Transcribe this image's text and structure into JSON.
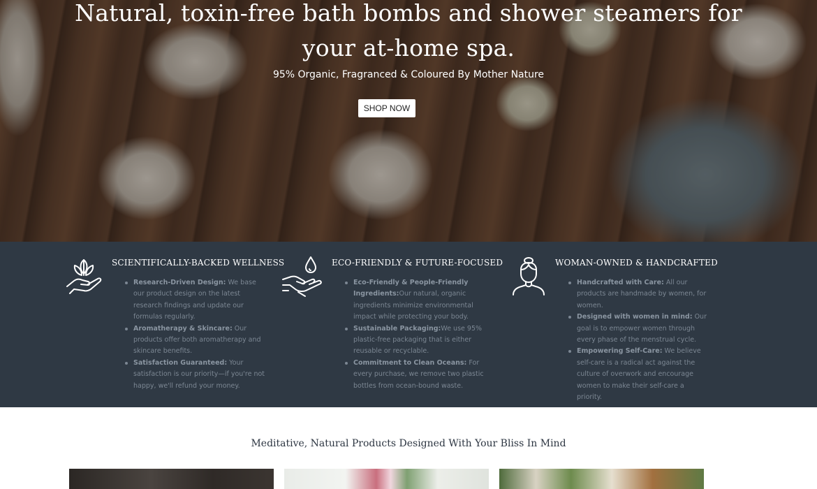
{
  "hero": {
    "title": "Natural, toxin-free bath bombs and shower steamers for your at-home spa.",
    "subtitle": "95% Organic, Fragranced & Coloured By Mother Nature",
    "cta_label": "SHOP NOW"
  },
  "features": [
    {
      "icon": "hand-plant-icon",
      "title": "SCIENTIFICALLY-BACKED WELLNESS",
      "items": [
        {
          "heading": "Research-Driven Design:",
          "text": " We base our product design on the latest research findings and update our formulas regularly."
        },
        {
          "heading": "Aromatherapy & Skincare:",
          "text": " Our products offer both aromatherapy and skincare benefits."
        },
        {
          "heading": "Satisfaction Guaranteed:",
          "text": " Your satisfaction is our priority—if you're not happy, we'll refund your money."
        }
      ]
    },
    {
      "icon": "hand-water-drop-icon",
      "title": "ECO-FRIENDLY & FUTURE-FOCUSED",
      "items": [
        {
          "heading": "Eco-Friendly & People-Friendly Ingredients:",
          "text": "Our natural, organic ingredients minimize environmental impact while protecting your body."
        },
        {
          "heading": "Sustainable Packaging:",
          "text": "We use 95% plastic-free packaging that is either reusable or recyclable."
        },
        {
          "heading": "Commitment to Clean Oceans:",
          "text": " For every purchase, we remove two plastic bottles from ocean-bound waste."
        }
      ]
    },
    {
      "icon": "woman-icon",
      "title": "WOMAN-OWNED & HANDCRAFTED",
      "items": [
        {
          "heading": "Handcrafted with Care:",
          "text": " All our products are handmade by women, for women."
        },
        {
          "heading": "Designed with women in mind:",
          "text": " Our goal is to empower women through every phase of the menstrual cycle."
        },
        {
          "heading": "Empowering Self-Care:",
          "text": " We believe self-care is a radical act against the culture of overwork and encourage women to make their self-care a priority."
        }
      ]
    }
  ],
  "products_section": {
    "title": "Meditative, Natural Products Designed With Your Bliss In Mind"
  }
}
